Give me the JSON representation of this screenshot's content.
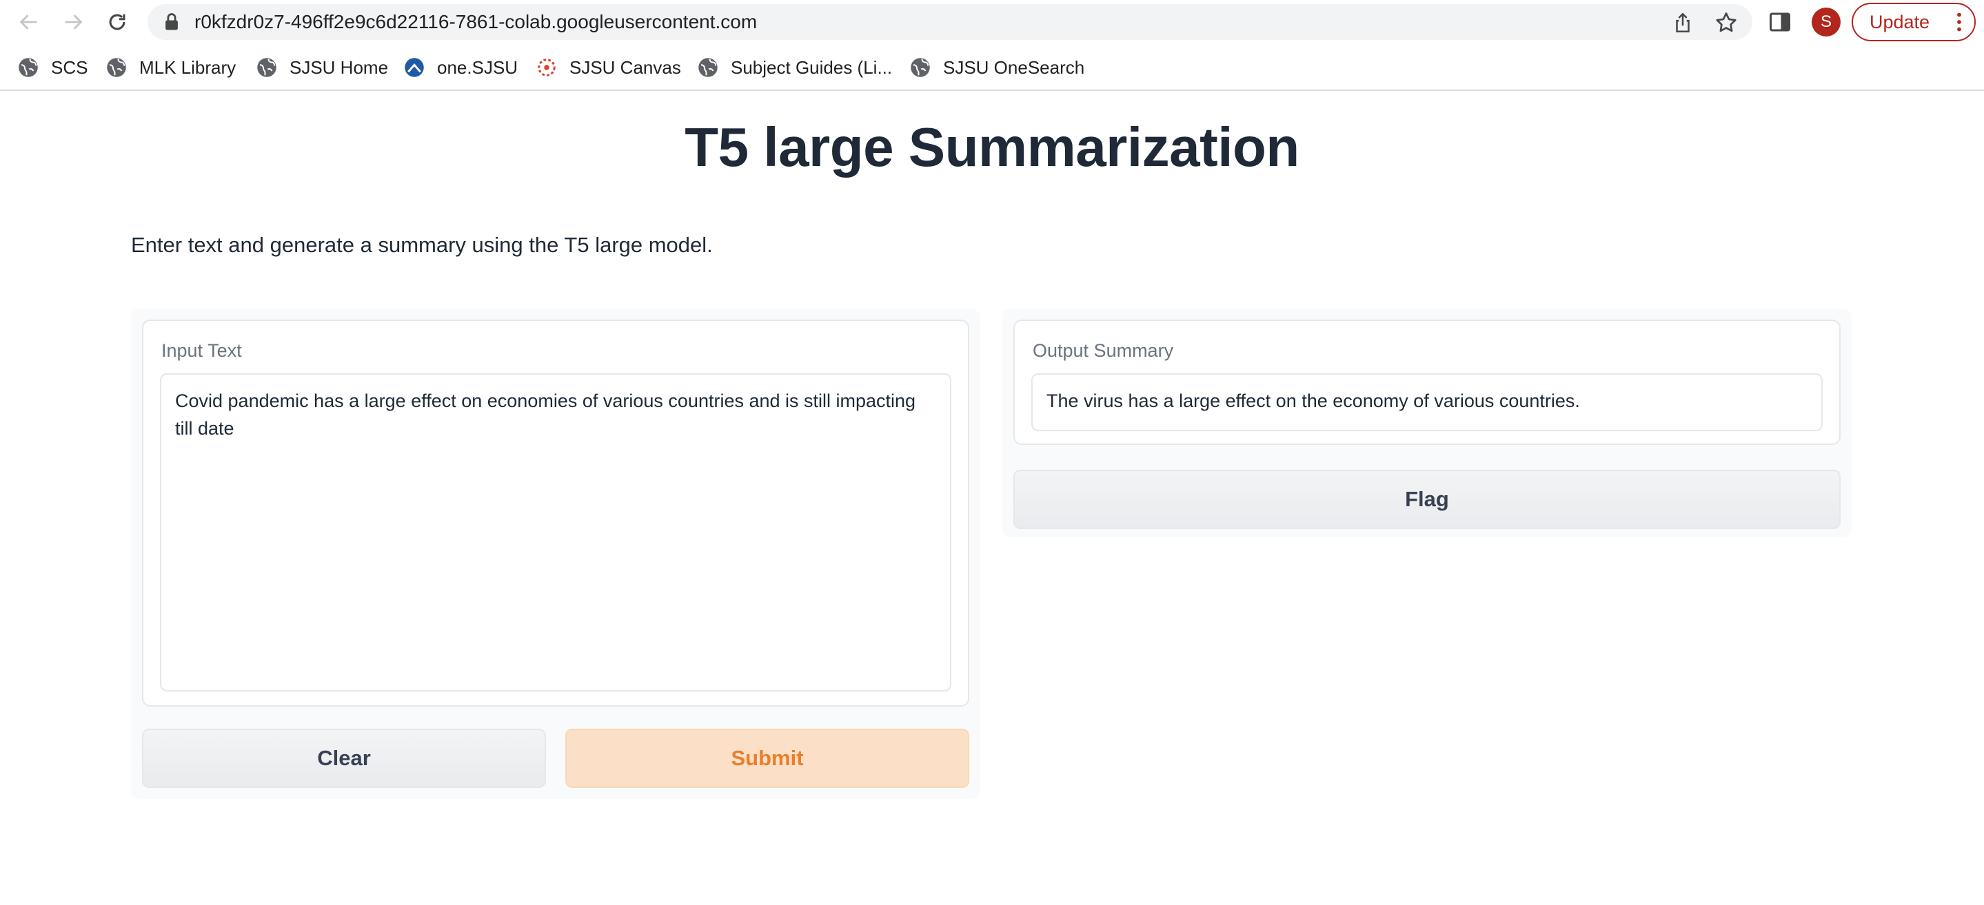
{
  "browser": {
    "url": "r0kfzdr0z7-496ff2e9c6d22116-7861-colab.googleusercontent.com",
    "avatar_letter": "S",
    "update_label": "Update",
    "icons": {
      "back": "arrow-left-icon",
      "forward": "arrow-right-icon",
      "reload": "reload-icon",
      "lock": "lock-icon",
      "share": "share-icon",
      "bookmark": "star-icon",
      "side_panel": "side-panel-icon",
      "menu": "kebab-menu-icon"
    },
    "accent_color": "#b3261e"
  },
  "bookmarks": [
    {
      "label": "SCS",
      "icon": "globe-icon"
    },
    {
      "label": "MLK Library",
      "icon": "globe-icon"
    },
    {
      "label": "SJSU Home",
      "icon": "globe-icon"
    },
    {
      "label": "one.SJSU",
      "icon": "one-sjsu-icon"
    },
    {
      "label": "SJSU Canvas",
      "icon": "canvas-icon"
    },
    {
      "label": "Subject Guides (Li...",
      "icon": "globe-icon"
    },
    {
      "label": "SJSU OneSearch",
      "icon": "globe-icon"
    }
  ],
  "app": {
    "title": "T5 large Summarization",
    "description": "Enter text and generate a summary using the T5 large model.",
    "input": {
      "label": "Input Text",
      "value": "Covid pandemic has a large effect on economies of various countries and is still impacting till date"
    },
    "output": {
      "label": "Output Summary",
      "value": "The virus has a large effect on the economy of various countries."
    },
    "buttons": {
      "clear": "Clear",
      "submit": "Submit",
      "flag": "Flag"
    },
    "colors": {
      "primary_button_bg": "#fbe0c7",
      "primary_button_text": "#ea7f2a",
      "secondary_button_bg": "#f3f4f6"
    }
  }
}
